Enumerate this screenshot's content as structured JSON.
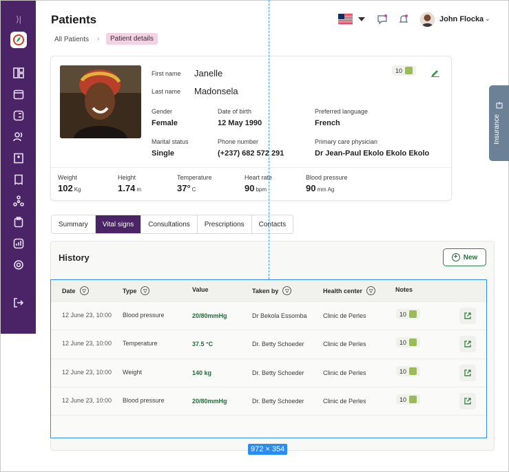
{
  "header": {
    "title": "Patients",
    "breadcrumb": {
      "root": "All Patients",
      "current": "Patient details"
    },
    "user": {
      "name": "John Flocka"
    }
  },
  "patient": {
    "first_name_label": "First name",
    "first_name": "Janelle",
    "last_name_label": "Last name",
    "last_name": "Madonsela",
    "gender_label": "Gender",
    "gender": "Female",
    "dob_label": "Date of birth",
    "dob": "12 May 1990",
    "language_label": "Preferred language",
    "language": "French",
    "marital_label": "Marital status",
    "marital": "Single",
    "phone_label": "Phone number",
    "phone": "(+237) 682 572 291",
    "physician_label": "Primary care physician",
    "physician": "Dr Jean-Paul Ekolo Ekolo Ekolo",
    "notes_count": "10"
  },
  "vitals": [
    {
      "label": "Weight",
      "value": "102",
      "unit": "Kg"
    },
    {
      "label": "Height",
      "value": "1.74",
      "unit": "m"
    },
    {
      "label": "Temperature",
      "value": "37°",
      "unit": "C"
    },
    {
      "label": "Heart rate",
      "value": "90",
      "unit": "bpm"
    },
    {
      "label": "Blood pressure",
      "value": "90",
      "unit": "mm Ag"
    }
  ],
  "tabs": [
    "Summary",
    "Vital signs",
    "Consultations",
    "Prescriptions",
    "Contacts"
  ],
  "history": {
    "title": "History",
    "new_label": "New",
    "columns": [
      "Date",
      "Type",
      "Value",
      "Taken by",
      "Health center",
      "Notes"
    ],
    "rows": [
      {
        "date": "12 June 23, 10:00",
        "type": "Blood pressure",
        "value": "20/80mmHg",
        "taken_by": "Dr Bekola Essomba",
        "center": "Clinic de Perles",
        "notes": "10"
      },
      {
        "date": "12 June 23, 10:00",
        "type": "Temperature",
        "value": "37.5 °C",
        "taken_by": "Dr. Betty Schoeder",
        "center": "Clinic de Perles",
        "notes": "10"
      },
      {
        "date": "12 June 23, 10:00",
        "type": "Weight",
        "value": "140 kg",
        "taken_by": "Dr. Betty Schoeder",
        "center": "Clinic de Perles",
        "notes": "10"
      },
      {
        "date": "12 June 23, 10:00",
        "type": "Blood pressure",
        "value": "20/80mmHg",
        "taken_by": "Dr. Betty Schoeder",
        "center": "Clinic de Perles",
        "notes": "10"
      }
    ]
  },
  "overlay": {
    "dimensions": "972 × 354"
  },
  "side_tab": {
    "label": "Insurance"
  },
  "colors": {
    "brand": "#4a2466",
    "accent_green": "#1f6b3a",
    "selection": "#2d8cf0"
  }
}
